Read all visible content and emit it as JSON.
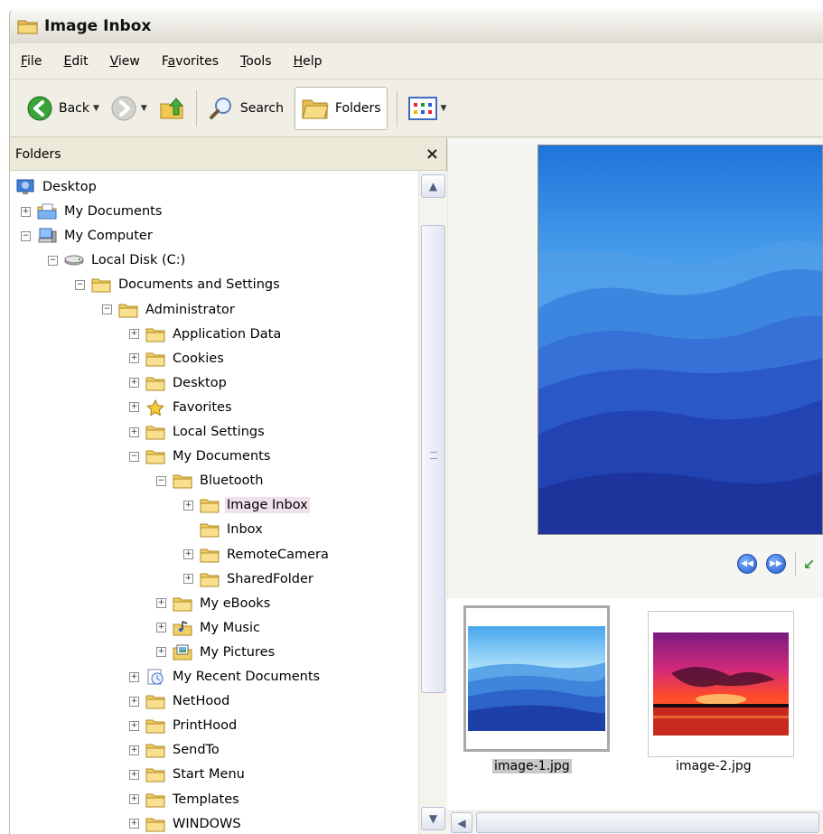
{
  "window": {
    "title": "Image Inbox"
  },
  "menu": [
    {
      "label": "File",
      "accel": "F",
      "rest": "ile"
    },
    {
      "label": "Edit",
      "accel": "E",
      "rest": "dit"
    },
    {
      "label": "View",
      "accel": "V",
      "rest": "iew"
    },
    {
      "label": "Favorites",
      "accel": "a",
      "pre": "F",
      "rest": "vorites"
    },
    {
      "label": "Tools",
      "accel": "T",
      "rest": "ools"
    },
    {
      "label": "Help",
      "accel": "H",
      "rest": "elp"
    }
  ],
  "toolbar": {
    "back": "Back",
    "search": "Search",
    "folders": "Folders"
  },
  "folders_pane": {
    "title": "Folders",
    "close": "×"
  },
  "tree": [
    {
      "label": "Desktop",
      "depth": 0,
      "exp": "",
      "icon": "desktop-icon"
    },
    {
      "label": "My Documents",
      "depth": 1,
      "exp": "+",
      "icon": "my-documents-icon"
    },
    {
      "label": "My Computer",
      "depth": 1,
      "exp": "−",
      "icon": "my-computer-icon"
    },
    {
      "label": "Local Disk (C:)",
      "depth": 2,
      "exp": "−",
      "icon": "disk-icon"
    },
    {
      "label": "Documents and Settings",
      "depth": 3,
      "exp": "−",
      "icon": "folder-icon"
    },
    {
      "label": "Administrator",
      "depth": 4,
      "exp": "−",
      "icon": "folder-icon"
    },
    {
      "label": "Application Data",
      "depth": 5,
      "exp": "+",
      "icon": "folder-icon"
    },
    {
      "label": "Cookies",
      "depth": 5,
      "exp": "+",
      "icon": "folder-icon"
    },
    {
      "label": "Desktop",
      "depth": 5,
      "exp": "+",
      "icon": "folder-icon"
    },
    {
      "label": "Favorites",
      "depth": 5,
      "exp": "+",
      "icon": "star-icon"
    },
    {
      "label": "Local Settings",
      "depth": 5,
      "exp": "+",
      "icon": "folder-icon"
    },
    {
      "label": "My Documents",
      "depth": 5,
      "exp": "−",
      "icon": "folder-icon"
    },
    {
      "label": "Bluetooth",
      "depth": 6,
      "exp": "−",
      "icon": "folder-icon"
    },
    {
      "label": "Image Inbox",
      "depth": 7,
      "exp": "+",
      "icon": "folder-icon",
      "selected": true
    },
    {
      "label": "Inbox",
      "depth": 7,
      "exp": "",
      "icon": "folder-icon"
    },
    {
      "label": "RemoteCamera",
      "depth": 7,
      "exp": "+",
      "icon": "folder-icon"
    },
    {
      "label": "SharedFolder",
      "depth": 7,
      "exp": "+",
      "icon": "folder-icon"
    },
    {
      "label": "My eBooks",
      "depth": 6,
      "exp": "+",
      "icon": "folder-icon"
    },
    {
      "label": "My Music",
      "depth": 6,
      "exp": "+",
      "icon": "music-folder-icon"
    },
    {
      "label": "My Pictures",
      "depth": 6,
      "exp": "+",
      "icon": "pictures-folder-icon"
    },
    {
      "label": "My Recent Documents",
      "depth": 5,
      "exp": "+",
      "icon": "recent-docs-icon"
    },
    {
      "label": "NetHood",
      "depth": 5,
      "exp": "+",
      "icon": "folder-icon"
    },
    {
      "label": "PrintHood",
      "depth": 5,
      "exp": "+",
      "icon": "folder-icon"
    },
    {
      "label": "SendTo",
      "depth": 5,
      "exp": "+",
      "icon": "folder-icon"
    },
    {
      "label": "Start Menu",
      "depth": 5,
      "exp": "+",
      "icon": "folder-icon"
    },
    {
      "label": "Templates",
      "depth": 5,
      "exp": "+",
      "icon": "folder-icon"
    },
    {
      "label": "WINDOWS",
      "depth": 5,
      "exp": "+",
      "icon": "folder-icon"
    }
  ],
  "filmstrip": [
    {
      "name": "image-1.jpg",
      "selected": true,
      "scene": "mountains"
    },
    {
      "name": "image-2.jpg",
      "selected": false,
      "scene": "sunset"
    }
  ],
  "colors": {
    "selection": "#efe2ea",
    "preview_sky": "#2b7fe0",
    "mountain_dark": "#1a3aa8"
  }
}
